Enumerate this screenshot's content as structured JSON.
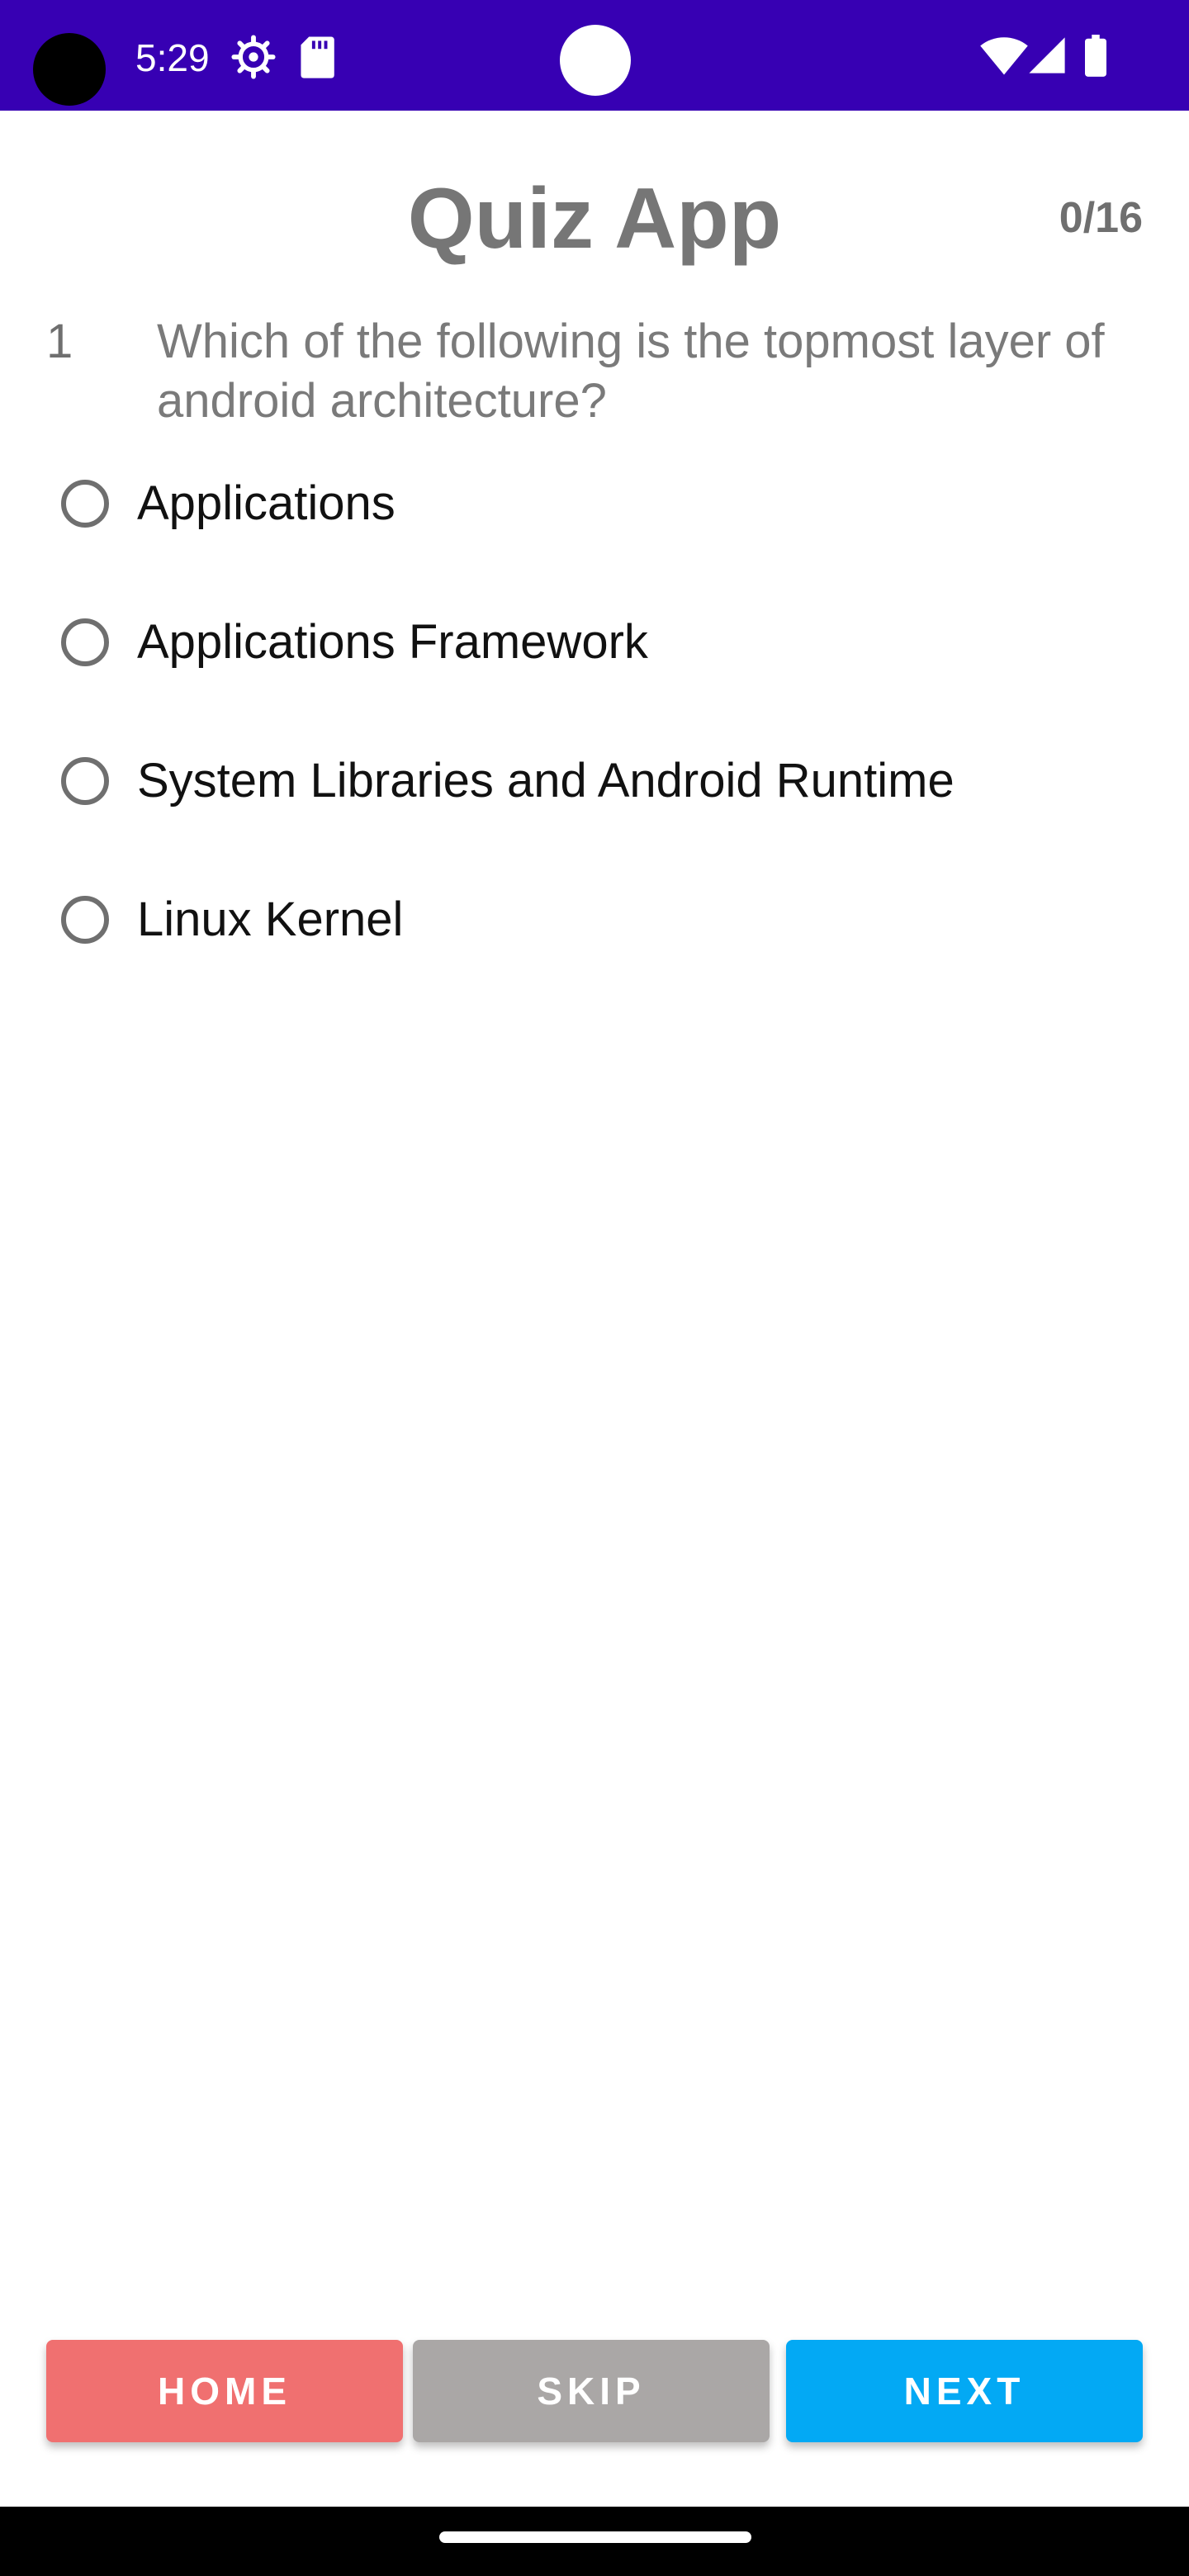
{
  "status_bar": {
    "time": "5:29",
    "background_color": "#3700b3",
    "icons": [
      "settings-gear-icon",
      "sd-card-icon",
      "wifi-icon",
      "cellular-signal-icon",
      "battery-icon"
    ]
  },
  "header": {
    "title": "Quiz App",
    "progress": "0/16"
  },
  "question": {
    "number": "1",
    "text": "Which of the following is the topmost layer of android architecture?"
  },
  "options": [
    {
      "label": "Applications",
      "selected": false
    },
    {
      "label": "Applications Framework",
      "selected": false
    },
    {
      "label": "System Libraries and Android Runtime",
      "selected": false
    },
    {
      "label": "Linux Kernel",
      "selected": false
    }
  ],
  "buttons": {
    "home": {
      "label": "HOME",
      "color": "#f07070"
    },
    "skip": {
      "label": "SKIP",
      "color": "#aaa7a6"
    },
    "next": {
      "label": "NEXT",
      "color": "#03a9f4"
    }
  }
}
